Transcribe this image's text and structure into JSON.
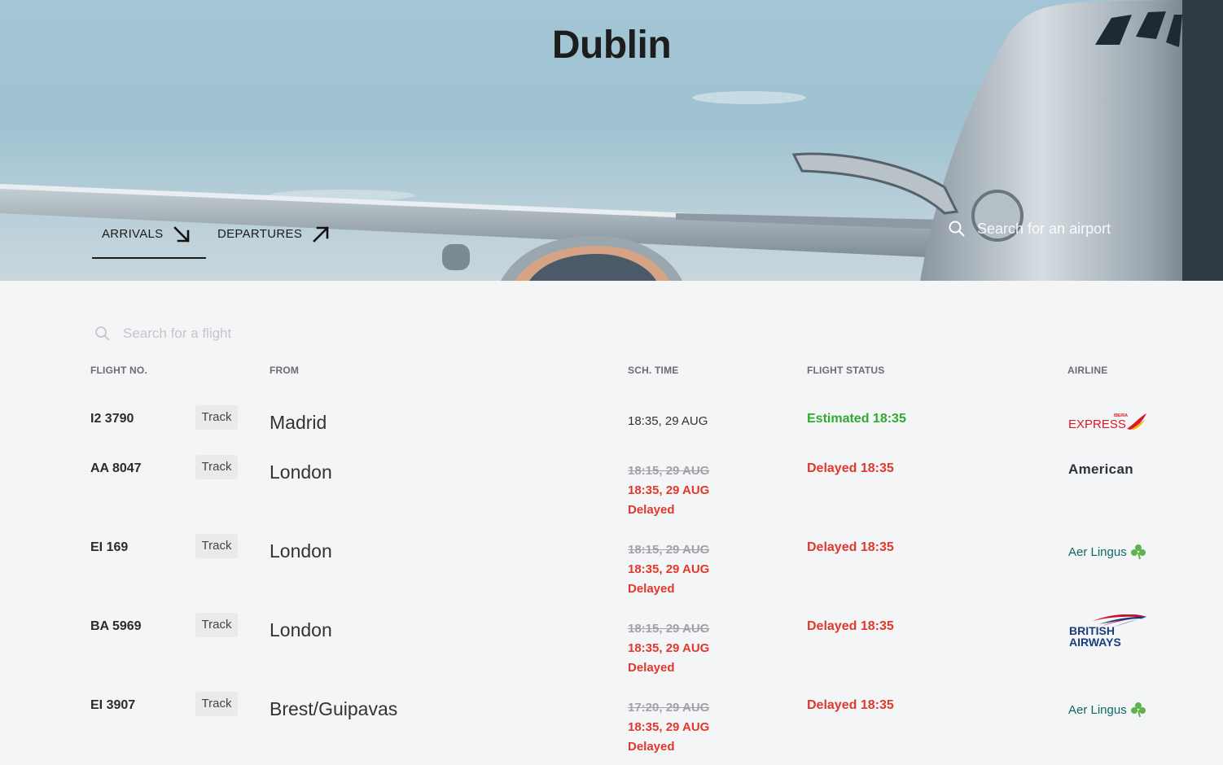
{
  "hero": {
    "city": "Dublin",
    "tabs": [
      {
        "label": "ARRIVALS",
        "active": true
      },
      {
        "label": "DEPARTURES",
        "active": false
      }
    ],
    "airport_search_placeholder": "Search for an airport"
  },
  "flight_search_placeholder": "Search for a flight",
  "columns": {
    "flight_no": "FLIGHT NO.",
    "from": "FROM",
    "sch_time": "SCH. TIME",
    "flight_status": "FLIGHT STATUS",
    "airline": "AIRLINE"
  },
  "track_label": "Track",
  "flights": [
    {
      "flight_no": "I2 3790",
      "from": "Madrid",
      "sched": "18:35, 29 AUG",
      "new_time": "",
      "note": "",
      "status": "Estimated 18:35",
      "status_color": "#2eab2e",
      "airline_logo": "iberia-express-logo",
      "airline_text": "EXPRESS",
      "airline_subtext": "IBERIA"
    },
    {
      "flight_no": "AA 8047",
      "from": "London",
      "sched": "18:15, 29 AUG",
      "new_time": "18:35, 29 AUG",
      "note": "Delayed",
      "status": "Delayed 18:35",
      "status_color": "#e0392b",
      "airline_logo": "american-logo",
      "airline_text": "American",
      "airline_subtext": ""
    },
    {
      "flight_no": "EI 169",
      "from": "London",
      "sched": "18:15, 29 AUG",
      "new_time": "18:35, 29 AUG",
      "note": "Delayed",
      "status": "Delayed 18:35",
      "status_color": "#e0392b",
      "airline_logo": "aer-lingus-logo",
      "airline_text": "Aer Lingus",
      "airline_subtext": ""
    },
    {
      "flight_no": "BA 5969",
      "from": "London",
      "sched": "18:15, 29 AUG",
      "new_time": "18:35, 29 AUG",
      "note": "Delayed",
      "status": "Delayed 18:35",
      "status_color": "#e0392b",
      "airline_logo": "british-airways-logo",
      "airline_text": "BRITISH",
      "airline_subtext": "AIRWAYS"
    },
    {
      "flight_no": "EI 3907",
      "from": "Brest/Guipavas",
      "sched": "17:20, 29 AUG",
      "new_time": "18:35, 29 AUG",
      "note": "Delayed",
      "status": "Delayed 18:35",
      "status_color": "#e0392b",
      "airline_logo": "aer-lingus-logo",
      "airline_text": "Aer Lingus",
      "airline_subtext": ""
    }
  ]
}
